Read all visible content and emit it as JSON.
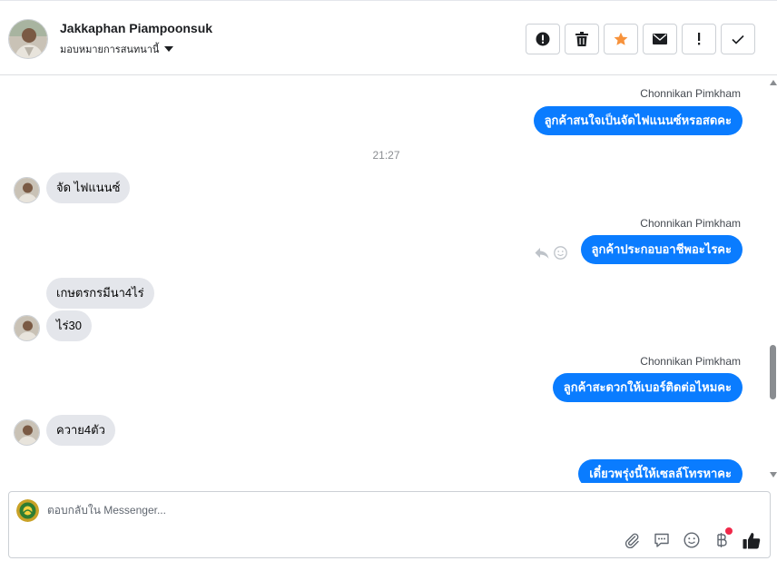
{
  "header": {
    "contact_name": "Jakkaphan Piampoonsuk",
    "assign_label": "มอบหมายการสนทนานี้",
    "actions": [
      {
        "icon": "alert-circle-icon"
      },
      {
        "icon": "trash-icon"
      },
      {
        "icon": "star-icon"
      },
      {
        "icon": "envelope-icon"
      },
      {
        "icon": "exclamation-icon"
      },
      {
        "icon": "checkmark-icon"
      }
    ]
  },
  "thread": {
    "messages": [
      {
        "sender": "Chonnikan Pimkham",
        "text": "ลูกค้าสนใจเป็นจัดไฟแนนซ์หรอสดคะ"
      },
      {
        "timestamp": "21:27"
      },
      {
        "text": "จัด ไฟแนนซ์"
      },
      {
        "sender": "Chonnikan Pimkham",
        "text": "ลูกค้าประกอบอาชีพอะไรคะ"
      },
      {
        "text": "เกษตรกรมีนา4ไร่"
      },
      {
        "text": "ไร่30"
      },
      {
        "sender": "Chonnikan Pimkham",
        "text": "ลูกค้าสะดวกให้เบอร์ติดต่อไหมคะ"
      },
      {
        "text": "ควาย4ตัว"
      },
      {
        "text": "เดี๋ยวพรุ่งนี้ให้เซลล์โทรหาคะ"
      }
    ]
  },
  "composer": {
    "placeholder": "ตอบกลับใน Messenger...",
    "tools": [
      "paperclip-icon",
      "quick-reply-icon",
      "emoji-icon",
      "baht-payment-icon",
      "thumbs-up-icon"
    ]
  },
  "colors": {
    "accent": "#0a7cff",
    "incoming_bubble": "#e4e6eb",
    "star": "#f7923b",
    "notification_dot": "#f02849"
  }
}
